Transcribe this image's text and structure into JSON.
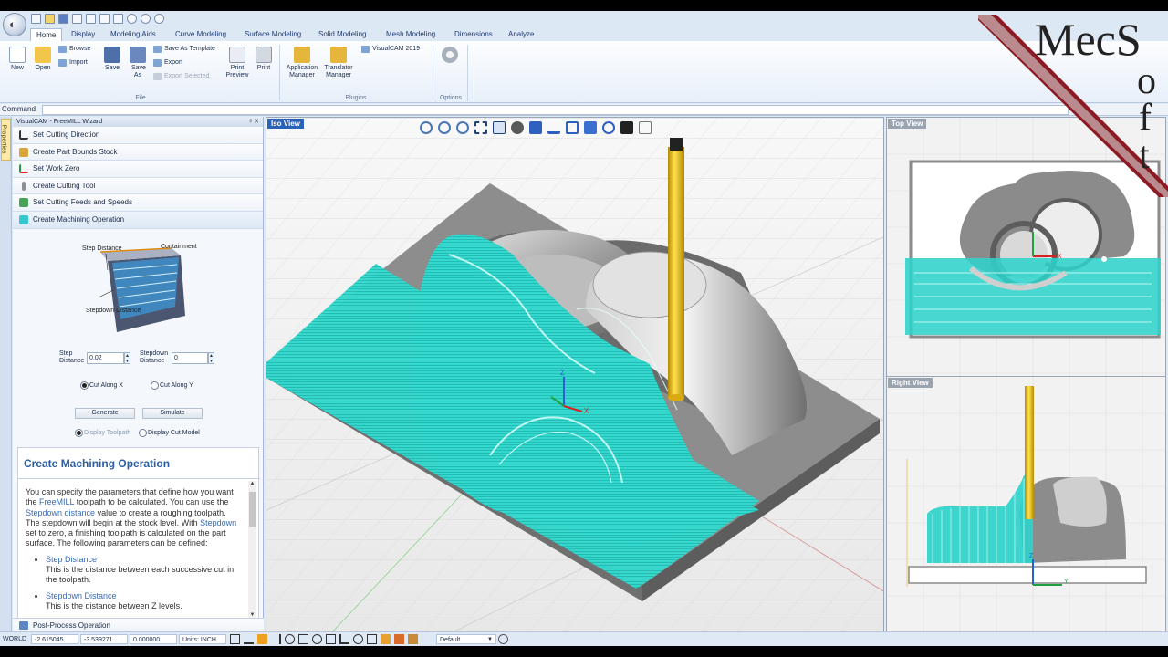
{
  "ribbon_tabs": [
    "Home",
    "Display",
    "Modeling Aids",
    "Curve Modeling",
    "Surface Modeling",
    "Solid Modeling",
    "Mesh Modeling",
    "Dimensions",
    "Analyze"
  ],
  "ribbon": {
    "new": "New",
    "open": "Open",
    "browse": "Browse",
    "import": "Import",
    "save": "Save",
    "save_as": "Save As",
    "save_as_template": "Save As Template",
    "export": "Export",
    "export_selected": "Export Selected",
    "print_preview": "Print Preview",
    "print": "Print",
    "file_group": "File",
    "application_manager": "Application Manager",
    "translator_manager": "Translator Manager",
    "visualcam_2019": "VisualCAM 2019",
    "plugins_group": "Plugins",
    "options_group": "Options"
  },
  "command": {
    "label": "Command",
    "value": ""
  },
  "properties_tab": "Properties",
  "wizard": {
    "title": "VisualCAM - FreeMILL Wizard",
    "steps": [
      "Set Cutting Direction",
      "Create Part Bounds Stock",
      "Set Work Zero",
      "Create Cutting Tool",
      "Set Cutting Feeds and Speeds",
      "Create Machining Operation"
    ],
    "diagram_labels": {
      "step_distance": "Step Distance",
      "containment": "Containment",
      "stepdown_distance": "Stepdown Distance"
    },
    "step_distance_label": "Step Distance",
    "step_distance_value": "0.02",
    "stepdown_distance_label": "Stepdown Distance",
    "stepdown_distance_value": "0",
    "cut_along_x": "Cut Along X",
    "cut_along_y": "Cut Along Y",
    "generate": "Generate",
    "simulate": "Simulate",
    "display_toolpath": "Display Toolpath",
    "display_cut_model": "Display Cut Model",
    "post_process": "Post-Process Operation"
  },
  "help": {
    "heading": "Create Machining Operation",
    "p1_a": "You can specify the parameters that define how you want the ",
    "p1_link1": "FreeMILL",
    "p1_b": " toolpath to be calculated.  You can use the ",
    "p1_link2": "Stepdown distance",
    "p1_c": " value to create a roughing toolpath.  The stepdown will begin at the stock level.  With ",
    "p1_link3": "Stepdown",
    "p1_d": " set to zero, a finishing toolpath is calculated on the part surface. The following parameters can be defined:",
    "items": [
      {
        "name": "Step Distance",
        "desc": "This is the distance between each successive cut in the toolpath."
      },
      {
        "name": "Stepdown Distance",
        "desc": "This is the distance between Z levels."
      }
    ]
  },
  "viewports": {
    "iso": "Iso View",
    "top": "Top View",
    "right": "Right View"
  },
  "status": {
    "world": "WORLD",
    "x": "-2.615045",
    "y": "-3.539271",
    "z": "0.000000",
    "units": "Units: INCH",
    "layer": "Default"
  },
  "logo": {
    "text_row": "MecS",
    "text_col": "oft"
  },
  "colors": {
    "toolpath": "#29d6cc",
    "tool": "#f0c419",
    "viewport_label_bg": "#2a62b8",
    "accent": "#c0303a"
  }
}
